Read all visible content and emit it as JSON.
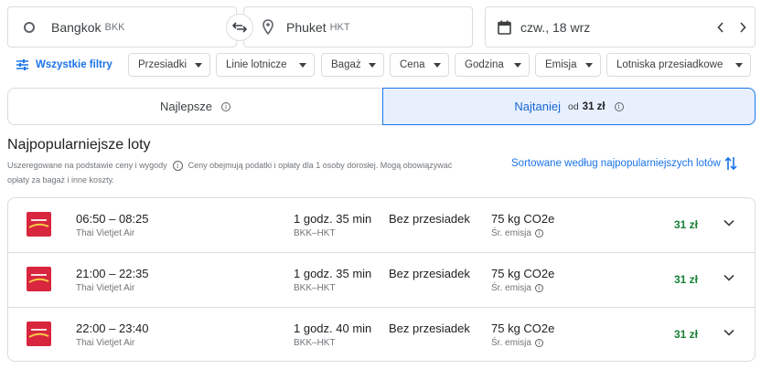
{
  "search": {
    "origin": {
      "city": "Bangkok",
      "code": "BKK"
    },
    "destination": {
      "city": "Phuket",
      "code": "HKT"
    },
    "date": "czw., 18 wrz"
  },
  "filters": {
    "all_filters_label": "Wszystkie filtry",
    "chips": [
      "Przesiadki",
      "Linie lotnicze",
      "Bagaż",
      "Cena",
      "Godzina",
      "Emisja",
      "Lotniska przesiadkowe"
    ]
  },
  "tabs": {
    "best": {
      "label": "Najlepsze"
    },
    "cheapest": {
      "label": "Najtaniej",
      "prefix": "od",
      "price": "31 zł"
    }
  },
  "section": {
    "title": "Najpopularniejsze loty",
    "desc_part1": "Uszeregowane na podstawie ceny i wygody",
    "desc_part2": "Ceny obejmują podatki i opłaty dla 1 osoby dorosłej. Mogą obowiązywać opłaty za bagaż i inne koszty.",
    "sort_label": "Sortowane według najpopularniejszych lotów"
  },
  "flights": [
    {
      "time": "06:50 – 08:25",
      "airline": "Thai Vietjet Air",
      "duration": "1 godz. 35 min",
      "route": "BKK–HKT",
      "stops": "Bez przesiadek",
      "co2": "75 kg CO2e",
      "emission": "Śr. emisja",
      "price": "31 zł"
    },
    {
      "time": "21:00 – 22:35",
      "airline": "Thai Vietjet Air",
      "duration": "1 godz. 35 min",
      "route": "BKK–HKT",
      "stops": "Bez przesiadek",
      "co2": "75 kg CO2e",
      "emission": "Śr. emisja",
      "price": "31 zł"
    },
    {
      "time": "22:00 – 23:40",
      "airline": "Thai Vietjet Air",
      "duration": "1 godz. 40 min",
      "route": "BKK–HKT",
      "stops": "Bez przesiadek",
      "co2": "75 kg CO2e",
      "emission": "Śr. emisja",
      "price": "31 zł"
    }
  ],
  "colors": {
    "accent": "#1a73e8",
    "price_green": "#188038",
    "selected_tab_bg": "#e8f0fe",
    "airline_logo": "#d7263d"
  },
  "icons": {
    "swap": "swap-arrows-icon",
    "destination": "location-pin-icon",
    "calendar": "calendar-icon",
    "filters": "tune-icon",
    "info": "info-icon",
    "sort": "sort-arrows-icon",
    "expand": "chevron-down-icon"
  }
}
